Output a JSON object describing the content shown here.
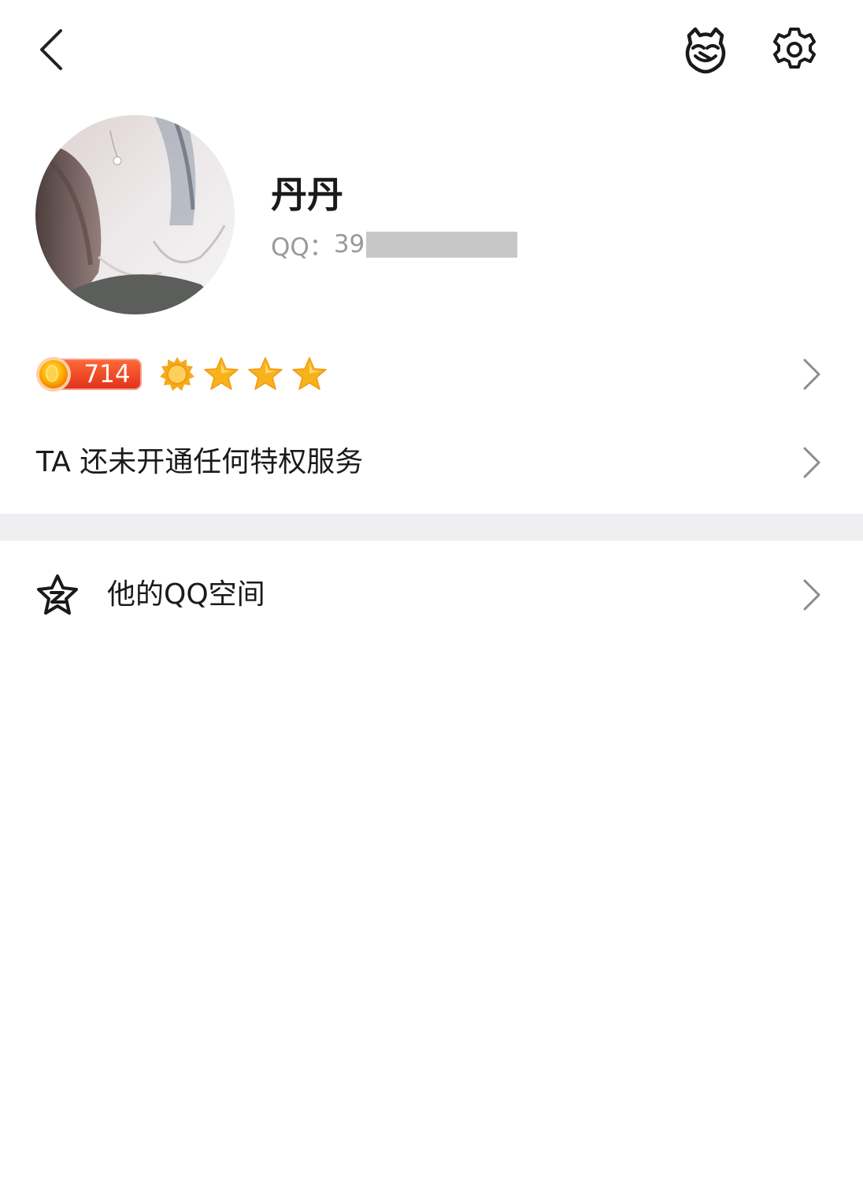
{
  "header": {
    "back_icon": "chevron-left-icon",
    "pet_icon": "pet-icon",
    "settings_icon": "gear-icon"
  },
  "profile": {
    "nickname": "丹丹",
    "qq_label": "QQ：",
    "qq_number_visible": "39",
    "qq_number_masked": true
  },
  "level": {
    "badge_value": "714",
    "icons": [
      "sun-icon",
      "star-icon",
      "star-icon",
      "star-icon"
    ],
    "badge_color": "#f0401e",
    "star_color": "#f7b21c"
  },
  "privilege": {
    "text": "TA 还未开通任何特权服务"
  },
  "qzone": {
    "icon": "qzone-star-icon",
    "label": "他的QQ空间"
  },
  "colors": {
    "divider": "#efeff1",
    "chevron": "#8c8c8c",
    "masked": "#c7c7c7"
  }
}
